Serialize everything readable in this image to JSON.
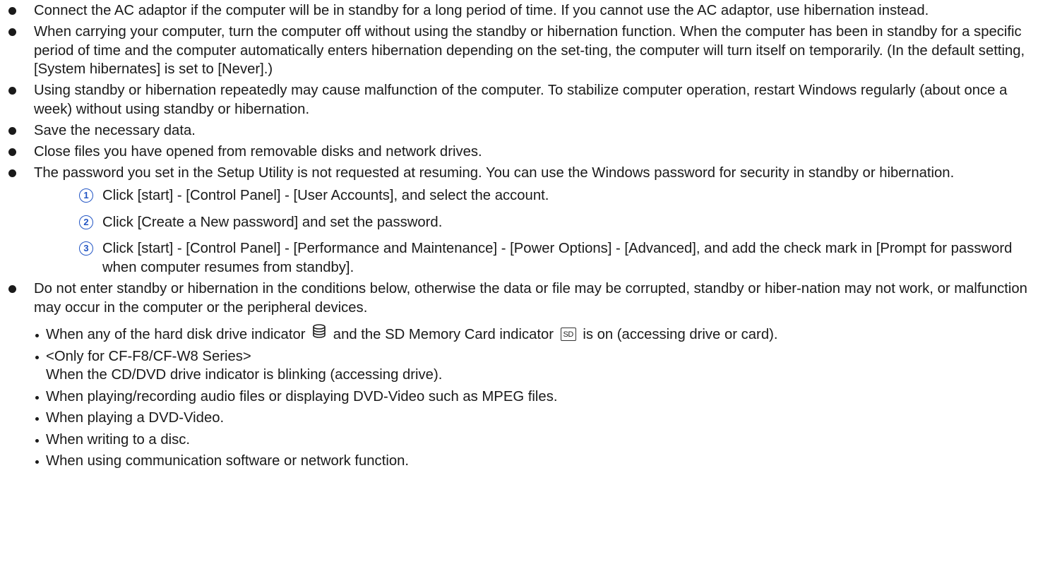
{
  "bullets": [
    {
      "text": "Connect the AC adaptor if the computer will be in standby for a long period of time. If you cannot use the AC adaptor, use hibernation instead."
    },
    {
      "text": "When carrying your computer, turn the computer off without using the standby or hibernation function. When the computer has been in standby for a specific period of time and the computer automatically enters hibernation depending on the set-ting, the computer will turn itself on temporarily. (In the default setting, [System hibernates] is set to [Never].)"
    },
    {
      "text": "Using standby or hibernation repeatedly may cause malfunction of the computer. To stabilize computer operation, restart Windows regularly (about once a week) without using standby or hibernation."
    },
    {
      "text": "Save the necessary data."
    },
    {
      "text": "Close files you have opened from removable disks and network drives."
    },
    {
      "text": "The password you set in the Setup Utility is not requested at resuming. You can use the Windows password for security in standby or hibernation."
    },
    {
      "text": "Do not enter standby or hibernation in the conditions below, otherwise the data or file may be corrupted, standby or hiber-nation may not work, or malfunction may occur in the computer or the peripheral devices."
    }
  ],
  "steps": [
    {
      "num": "1",
      "text": "Click [start] - [Control Panel] - [User Accounts], and select the account."
    },
    {
      "num": "2",
      "text": "Click [Create a New password] and set the password."
    },
    {
      "num": "3",
      "text": "Click [start] - [Control Panel] - [Performance and Maintenance] - [Power Options] - [Advanced], and add the check mark in [Prompt for password when computer resumes from standby]."
    }
  ],
  "conditions": {
    "hdd_sd": {
      "before_hdd": "When any of the hard disk drive indicator",
      "between": "and the SD Memory Card indicator",
      "sd_label": "SD",
      "after_sd": "is on (accessing drive or card)."
    },
    "cd_series": "<Only for CF-F8/CF-W8 Series>",
    "cd_text": "When the CD/DVD drive indicator is blinking (accessing drive).",
    "items": [
      "When playing/recording audio files or displaying DVD-Video such as MPEG files.",
      "When playing a DVD-Video.",
      "When writing to a disc.",
      "When using communication software or network function."
    ]
  },
  "icons": {
    "bullet": "filled-circle-bullet",
    "hdd": "hard-disk-drive-indicator-icon",
    "sd": "sd-memory-card-indicator-icon",
    "step_number": "circled-number-icon"
  },
  "colors": {
    "text": "#1a1a1a",
    "step_number": "#2255c4"
  }
}
